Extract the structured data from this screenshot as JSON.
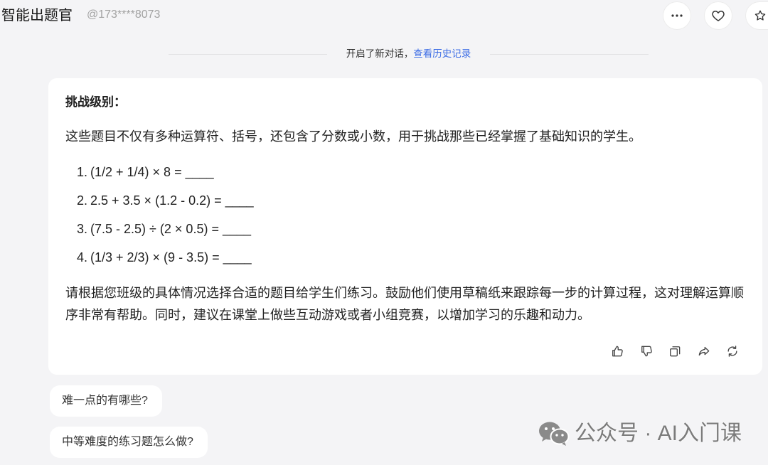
{
  "colors": {
    "page_background": "#f4f4f6",
    "card_background": "#ffffff",
    "text": "#222222",
    "muted_text": "#a2a2a2",
    "link": "#3e6ee5",
    "watermark": "#7b7b7b"
  },
  "header": {
    "title": "智能出题官",
    "handle": "@173****8073",
    "buttons": [
      "more-icon",
      "heart-icon",
      "star-icon"
    ]
  },
  "divider": {
    "text": "开启了新对话，",
    "link": "查看历史记录"
  },
  "message": {
    "heading": "挑战级别：",
    "intro": "这些题目不仅有多种运算符、括号，还包含了分数或小数，用于挑战那些已经掌握了基础知识的学生。",
    "questions": [
      {
        "number": "1.",
        "text": "(1/2 + 1/4) × 8 = ____"
      },
      {
        "number": "2.",
        "text": "2.5 + 3.5 × (1.2 - 0.2) = ____"
      },
      {
        "number": "3.",
        "text": "(7.5 - 2.5) ÷ (2 × 0.5) = ____"
      },
      {
        "number": "4.",
        "text": "(1/3 + 2/3) × (9 - 3.5) = ____"
      }
    ],
    "closing": "请根据您班级的具体情况选择合适的题目给学生们练习。鼓励他们使用草稿纸来跟踪每一步的计算过程，这对理解运算顺序非常有帮助。同时，建议在课堂上做些互动游戏或者小组竞赛，以增加学习的乐趣和动力。",
    "actions": [
      "thumbs-up-icon",
      "thumbs-down-icon",
      "copy-icon",
      "share-icon",
      "refresh-icon"
    ]
  },
  "suggestions": [
    "难一点的有哪些?",
    "中等难度的练习题怎么做?"
  ],
  "watermark": {
    "icon": "wechat-icon",
    "text": "公众号 · AI入门课"
  }
}
